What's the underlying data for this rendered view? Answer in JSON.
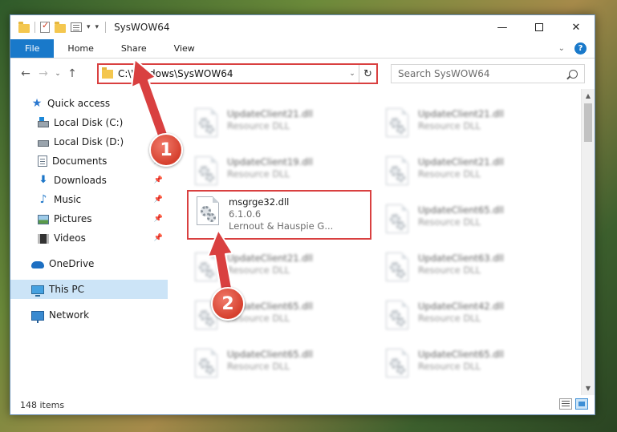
{
  "window": {
    "title": "SysWOW64",
    "controls": {
      "minimize": "—",
      "maximize": "",
      "close": "✕"
    }
  },
  "ribbon": {
    "tabs": [
      "File",
      "Home",
      "Share",
      "View"
    ],
    "help": "?"
  },
  "address": {
    "path": "C:\\Windows\\SysWOW64",
    "search_placeholder": "Search SysWOW64"
  },
  "nav": {
    "quick_access": "Quick access",
    "items": [
      {
        "label": "Local Disk (C:)",
        "pinned": true
      },
      {
        "label": "Local Disk (D:)",
        "pinned": true
      },
      {
        "label": "Documents",
        "pinned": true
      },
      {
        "label": "Downloads",
        "pinned": true
      },
      {
        "label": "Music",
        "pinned": true
      },
      {
        "label": "Pictures",
        "pinned": true
      },
      {
        "label": "Videos",
        "pinned": true
      }
    ],
    "onedrive": "OneDrive",
    "this_pc": "This PC",
    "network": "Network"
  },
  "files": {
    "selected": {
      "name": "msgrge32.dll",
      "version": "6.1.0.6",
      "company": "Lernout & Hauspie G..."
    },
    "left_column": [
      {
        "name": "UpdateClient21.dll",
        "type": "Resource DLL"
      },
      {
        "name": "UpdateClient19.dll",
        "type": "Resource DLL"
      },
      {
        "name": "UpdateClient21.dll",
        "type": "Resource DLL"
      },
      {
        "name": "UpdateClient65.dll",
        "type": "Resource DLL"
      },
      {
        "name": "UpdateClient65.dll",
        "type": "Resource DLL"
      }
    ],
    "right_column": [
      {
        "name": "UpdateClient21.dll",
        "type": "Resource DLL"
      },
      {
        "name": "UpdateClient21.dll",
        "type": "Resource DLL"
      },
      {
        "name": "UpdateClient65.dll",
        "type": "Resource DLL"
      },
      {
        "name": "UpdateClient63.dll",
        "type": "Resource DLL"
      },
      {
        "name": "UpdateClient42.dll",
        "type": "Resource DLL"
      },
      {
        "name": "UpdateClient65.dll",
        "type": "Resource DLL"
      }
    ]
  },
  "status": {
    "item_count": "148 items"
  },
  "annotations": {
    "step1": "1",
    "step2": "2",
    "color": "#d94040"
  }
}
